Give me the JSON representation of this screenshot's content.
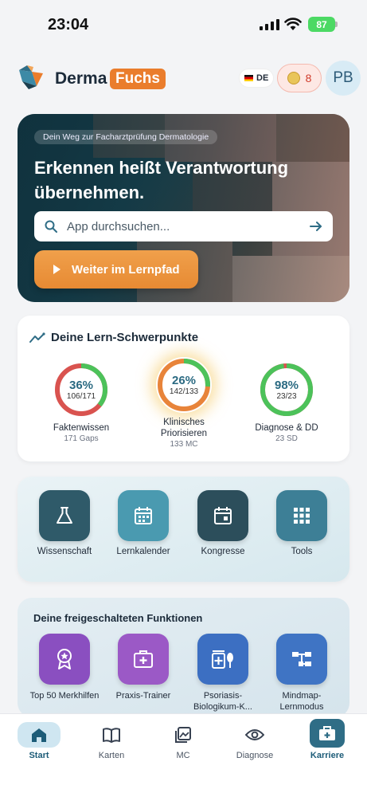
{
  "status": {
    "time": "23:04",
    "battery": "87"
  },
  "header": {
    "brand_part1": "Derma",
    "brand_part2": "Fuchs",
    "language": "DE",
    "coins": "8",
    "avatar_initials": "PB"
  },
  "hero": {
    "pill": "Dein Weg zur Facharztprüfung Dermatologie",
    "headline": "Erkennen heißt Verantwortung übernehmen.",
    "search_placeholder": "App durchsuchen...",
    "cta_label": "Weiter im Lernpfad"
  },
  "focus": {
    "title": "Deine Lern-Schwerpunkte",
    "items": [
      {
        "percent": "36%",
        "fraction": "106/171",
        "label": "Faktenwissen",
        "sub": "171 Gaps",
        "value": 0.36
      },
      {
        "percent": "26%",
        "fraction": "142/133",
        "label": "Klinisches Priorisieren",
        "sub": "133 MC",
        "value": 0.26
      },
      {
        "percent": "98%",
        "fraction": "23/23",
        "label": "Diagnose & DD",
        "sub": "23 SD",
        "value": 0.98
      }
    ]
  },
  "quick_tools": [
    {
      "label": "Wissenschaft",
      "icon": "flask-icon"
    },
    {
      "label": "Lernkalender",
      "icon": "calendar-icon"
    },
    {
      "label": "Kongresse",
      "icon": "event-icon"
    },
    {
      "label": "Tools",
      "icon": "grid-icon"
    }
  ],
  "features": {
    "title": "Deine freigeschalteten Funktionen",
    "items": [
      {
        "label": "Top 50 Merkhilfen",
        "icon": "award-icon"
      },
      {
        "label": "Praxis-Trainer",
        "icon": "medical-kit-icon"
      },
      {
        "label": "Psoriasis-Biologikum-K...",
        "icon": "medication-icon"
      },
      {
        "label": "Mindmap-Lernmodus",
        "icon": "mindmap-icon"
      }
    ]
  },
  "tabs": [
    {
      "label": "Start",
      "icon": "home-icon"
    },
    {
      "label": "Karten",
      "icon": "book-icon"
    },
    {
      "label": "MC",
      "icon": "gallery-icon"
    },
    {
      "label": "Diagnose",
      "icon": "eye-icon"
    },
    {
      "label": "Karriere",
      "icon": "briefcase-icon"
    }
  ],
  "colors": {
    "accent": "#ea7d2c",
    "primary": "#2f6d86",
    "ring_green": "#4cc25a",
    "ring_red": "#d9534f",
    "ring_orange": "#e8843a"
  }
}
